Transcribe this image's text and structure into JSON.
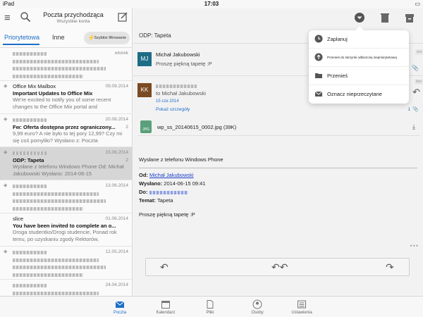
{
  "status": {
    "device": "iPad",
    "time": "17:03"
  },
  "left": {
    "title": "Poczta przychodząca",
    "subtitle": "Wszystkie konta",
    "tabs": [
      "Priorytetowa",
      "Inne"
    ],
    "filter_label": "Szybkie filtrowanie",
    "messages": [
      {
        "sender": "",
        "subject": "",
        "preview": "",
        "date": "wtorek",
        "count": "",
        "blurred": true,
        "selected": false
      },
      {
        "sender": "Office Mix Mailbox",
        "subject": "Important Updates to Office Mix",
        "preview": "We're excited to notify you of some recent changes to the Office Mix portal and",
        "date": "09.09.2014",
        "count": "",
        "blurred": false,
        "selected": false
      },
      {
        "sender": "",
        "subject": "Fw: Oferta dostępna przez ograniczony...",
        "preview": "9,99 euro? A nie było to tej pory 12,99? Czy mi się coś pomyliło? Wysłano z: Poczta",
        "date": "20.08.2014",
        "count": "2",
        "blurred": false,
        "selected": false
      },
      {
        "sender": "",
        "subject": "ODP: Tapeta",
        "preview": "Wysłane z telefonu Windows Phone Od: Michał Jakubowski Wysłano: 2014-06-15",
        "date": "15.06.2014",
        "count": "2",
        "blurred": false,
        "selected": true
      },
      {
        "sender": "",
        "subject": "",
        "preview": "",
        "date": "13.06.2014",
        "count": "",
        "blurred": true,
        "selected": false
      },
      {
        "sender": "slice",
        "subject": "You have been invited to complete an o...",
        "preview": "Droga studentko/Drogi studencie, Ponad rok temu, po uzyskaniu zgody Rektorów,",
        "date": "01.06.2014",
        "count": "",
        "blurred": false,
        "selected": false
      },
      {
        "sender": "",
        "subject": "",
        "preview": "",
        "date": "12.05.2014",
        "count": "",
        "blurred": true,
        "selected": false
      },
      {
        "sender": "",
        "subject": "",
        "preview": "",
        "date": "24.04.2014",
        "count": "",
        "blurred": true,
        "selected": false
      }
    ]
  },
  "right": {
    "conversation_title": "ODP: Tapeta",
    "mail1": {
      "initials": "MJ",
      "from": "Michał Jakubowski",
      "snippet": "Proszę piękną tapetę :P",
      "avatar_color": "#1d6d86"
    },
    "mail2": {
      "initials": "KK",
      "to": "to Michał Jakubowski",
      "date": "15 cze 2014",
      "details": "Pokaż szczegóły",
      "avatar_color": "#7a4a22",
      "count": "1"
    },
    "attachment": {
      "badge": "JPG",
      "name": "wp_ss_20140615_0002.jpg (39K)"
    },
    "body_signature": "Wysłane z telefonu Windows Phone",
    "headers": {
      "from_label": "Od:",
      "from_value": "Michał Jakubowski",
      "sent_label": "Wysłano:",
      "sent_value": "2014-06-15 09:41",
      "to_label": "Do:",
      "subject_label": "Temat:",
      "subject_value": "Tapeta"
    },
    "body_text": "Proszę piękną tapetę :P",
    "more": "•••"
  },
  "dropdown": {
    "items": [
      {
        "label": "Zaplanuj",
        "icon": "clock-icon"
      },
      {
        "label": "Przenieś do skrzynki odbiorczej nieprioirytetowej",
        "icon": "move-inbox-icon"
      },
      {
        "label": "Przenieś",
        "icon": "folder-icon"
      },
      {
        "label": "Oznacz nieprzeczytane",
        "icon": "envelope-icon"
      }
    ]
  },
  "tabbar": {
    "items": [
      "Poczta",
      "Kalendarz",
      "Pliki",
      "Osoby",
      "Ustawienia"
    ],
    "active_color": "#1e6ec8"
  }
}
